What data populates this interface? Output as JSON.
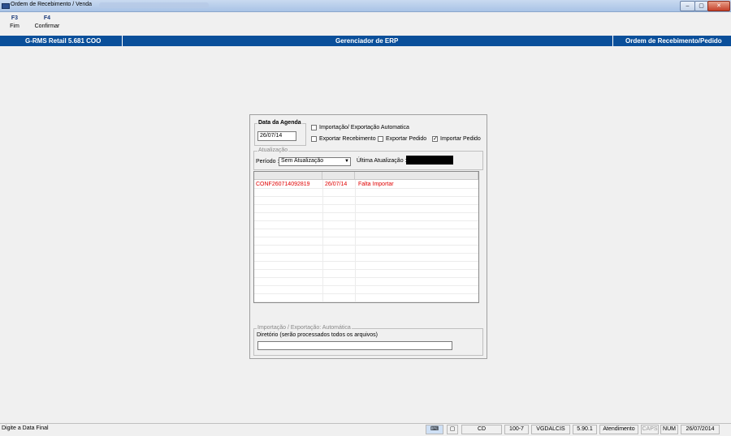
{
  "window": {
    "title": "Ordem de Recebimento / Venda",
    "controls": [
      "minimize",
      "maximize",
      "close"
    ]
  },
  "toolbar": [
    {
      "key": "F3",
      "label": "Fim"
    },
    {
      "key": "F4",
      "label": "Confirmar"
    }
  ],
  "header": {
    "left": "G-RMS Retail 5.681 COO",
    "center": "Gerenciador de ERP",
    "right": "Ordem de Recebimento/Pedido"
  },
  "dialog": {
    "agenda": {
      "legend": "Data da Agenda",
      "value": "26/07/14"
    },
    "options": {
      "auto_import_export": {
        "label": "Importação/ Exportação Automatica",
        "checked": false
      },
      "export_receipt": {
        "label": "Exportar Recebimento",
        "checked": false
      },
      "export_order": {
        "label": "Exportar Pedido",
        "checked": false
      },
      "import_order": {
        "label": "Importar Pedido",
        "checked": true
      }
    },
    "update": {
      "legend": "Atualização",
      "period_label": "Período :",
      "period_value": "Sem Atualização",
      "last_update_label": "Última Atualização :"
    },
    "grid": {
      "rows": [
        {
          "code": "CONF260714092819",
          "date": "26/07/14",
          "status": "Falta Importar"
        }
      ]
    },
    "auto": {
      "legend": "Importação / Exportação: Automática",
      "dir_label": "Diretório (serão processados todos os arquivos)",
      "dir_value": ""
    }
  },
  "status_bar": {
    "message": "Digite a Data Final",
    "cells": [
      "CD",
      "100-7",
      "VGDALCIS",
      "5.90.1",
      "Atendimento",
      "CAPS",
      "NUM",
      "26/07/2014"
    ]
  },
  "colors": {
    "header_blue": "#0a4f9a",
    "error_red": "#e00000"
  }
}
